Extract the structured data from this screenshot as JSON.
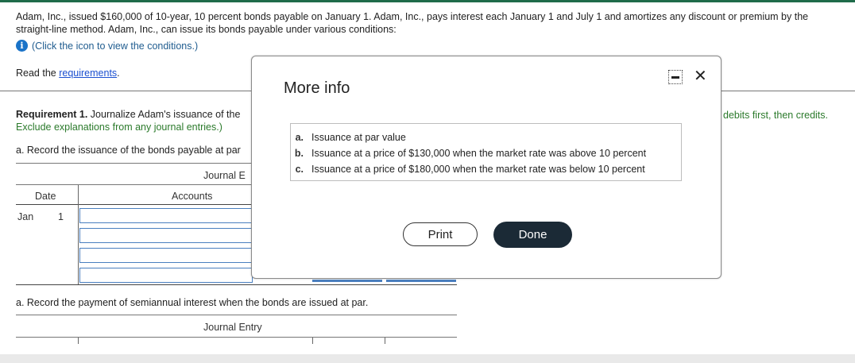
{
  "intro": "Adam, Inc., issued $160,000 of 10-year, 10 percent bonds payable on January 1. Adam, Inc., pays interest each January 1 and July 1 and amortizes any discount or premium by the straight-line method. Adam, Inc., can issue its bonds payable under various conditions:",
  "info_link": "(Click the icon to view the conditions.)",
  "read_prefix": "Read the ",
  "read_link": "requirements",
  "read_suffix": ".",
  "req1_bold": "Requirement 1.",
  "req1_text": " Journalize Adam's issuance of the",
  "req1_line2": "Exclude explanations from any journal entries.)",
  "req1_right": "debits first, then credits.",
  "rec_a1": "a. Record the issuance of the bonds payable at par",
  "journal_title1": "Journal E",
  "col_date": "Date",
  "col_accounts": "Accounts",
  "row_month": "Jan",
  "row_day": "1",
  "rec_a2": "a. Record the payment of semiannual interest when the bonds are issued at par.",
  "journal_title2": "Journal Entry",
  "modal": {
    "title": "More info",
    "conditions": [
      {
        "letter": "a.",
        "text": "Issuance at par value"
      },
      {
        "letter": "b.",
        "text": "Issuance at a price of $130,000 when the market rate was above 10 percent"
      },
      {
        "letter": "c.",
        "text": "Issuance at a price of $180,000 when the market rate was below 10 percent"
      }
    ],
    "print_label": "Print",
    "done_label": "Done",
    "close_glyph": "✕"
  },
  "colors": {
    "accent_green": "#1f6b4a",
    "done_bg": "#1b2a36",
    "link_blue": "#1a4fd0"
  }
}
